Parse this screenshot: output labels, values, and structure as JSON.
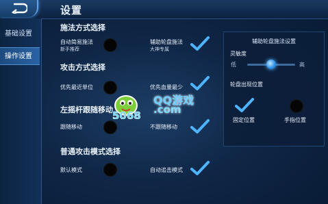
{
  "header": {
    "title": "设置"
  },
  "sidebar": {
    "items": [
      {
        "label": "基础设置"
      },
      {
        "label": "操作设置"
      }
    ]
  },
  "sections": [
    {
      "title": "施法方式选择",
      "option_a": {
        "label": "自动简易施法",
        "sub": "新手推荐",
        "checked": false
      },
      "option_b": {
        "label": "辅助轮盘施法",
        "sub": "大神专属",
        "checked": true
      }
    },
    {
      "title": "攻击方式选择",
      "option_a": {
        "label": "优先最近单位",
        "checked": false
      },
      "option_b": {
        "label": "优先血量最少",
        "checked": true
      }
    },
    {
      "title": "左摇杆跟随移动",
      "option_a": {
        "label": "跟随移动",
        "checked": false
      },
      "option_b": {
        "label": "不跟随移动",
        "checked": true
      }
    },
    {
      "title": "普通攻击模式选择",
      "option_a": {
        "label": "默认模式",
        "checked": false
      },
      "option_b": {
        "label": "自动追击模式",
        "checked": true
      }
    }
  ],
  "panel": {
    "title": "辅助轮盘施法设置",
    "sensitivity": {
      "label": "灵敏度",
      "low": "低",
      "high": "高",
      "value": 0.5
    },
    "position": {
      "label": "轮盘出现位置",
      "fixed": "固定位置",
      "finger": "手指位置",
      "selected": "fixed"
    }
  },
  "watermark": {
    "brand": "5068",
    "site_line1": "QQ游戏",
    "site_line2": ".com"
  },
  "colors": {
    "accent": "#3aa3ff",
    "check": "#4fb4ff",
    "background": "#0f2646"
  }
}
